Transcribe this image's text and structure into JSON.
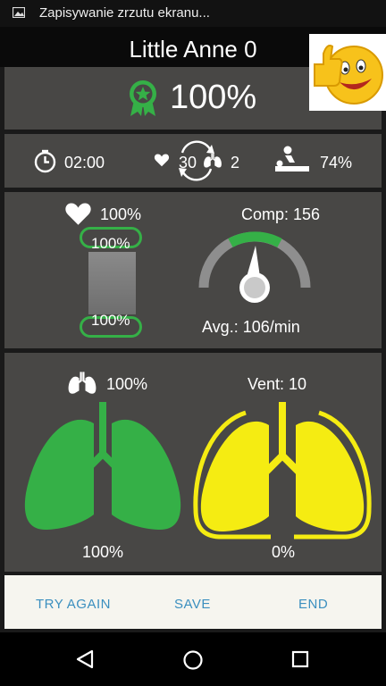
{
  "status_bar": {
    "notification_text": "Zapisywanie zrzutu ekranu..."
  },
  "header": {
    "title": "Little Anne 0"
  },
  "score": {
    "value": "100%"
  },
  "stats": {
    "time": "02:00",
    "compressions_cycle": "30",
    "ventilations_cycle": "2",
    "flow_fraction": "74%"
  },
  "compressions": {
    "overall": "100%",
    "release_percent": "100%",
    "depth_percent": "100%",
    "comp_label": "Comp: 156",
    "avg_rate": "Avg.: 106/min"
  },
  "ventilations": {
    "overall": "100%",
    "vent_label": "Vent: 10",
    "left_lung_percent": "100%",
    "right_lung_percent": "0%"
  },
  "buttons": {
    "try_again": "TRY AGAIN",
    "save": "SAVE",
    "end": "END"
  },
  "colors": {
    "panel": "#484745",
    "green": "#35b047",
    "yellow": "#f5ec12",
    "accent_blue": "#3b8fbf"
  },
  "icons": {
    "status": "image-icon",
    "score": "award-badge-icon",
    "timer": "stopwatch-icon",
    "heart": "heart-icon",
    "lungs": "lungs-icon",
    "cpr": "cpr-person-icon",
    "cycle": "cycle-arrows-icon"
  }
}
